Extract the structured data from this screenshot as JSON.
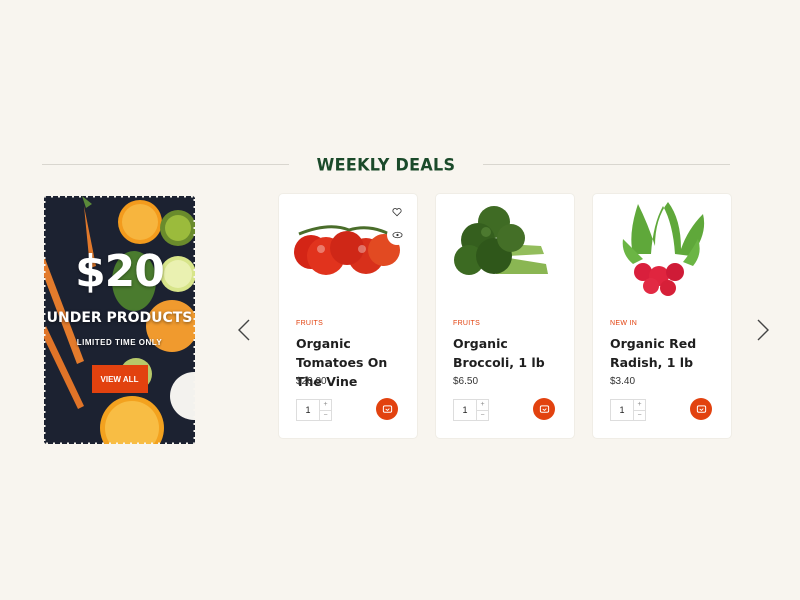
{
  "section": {
    "title": "WEEKLY DEALS"
  },
  "promo": {
    "price": "$20",
    "subtitle": "UNDER PRODUCTS",
    "tagline": "LIMITED TIME ONLY",
    "button_label": "VIEW ALL"
  },
  "carousel": {
    "prev_icon": "chevron-left-icon",
    "next_icon": "chevron-right-icon"
  },
  "products": [
    {
      "category": "FRUITS",
      "name": "Organic Tomatoes On The Vine",
      "price": "$20.00",
      "quantity": "1"
    },
    {
      "category": "FRUITS",
      "name": "Organic Broccoli, 1 lb",
      "price": "$6.50",
      "quantity": "1"
    },
    {
      "category": "NEW IN",
      "name": "Organic Red Radish, 1 lb",
      "price": "$3.40",
      "quantity": "1"
    }
  ],
  "qty_controls": {
    "increment": "+",
    "decrement": "−"
  },
  "colors": {
    "accent": "#e2420f",
    "heading": "#1b4a2a",
    "background": "#f8f5ef"
  }
}
